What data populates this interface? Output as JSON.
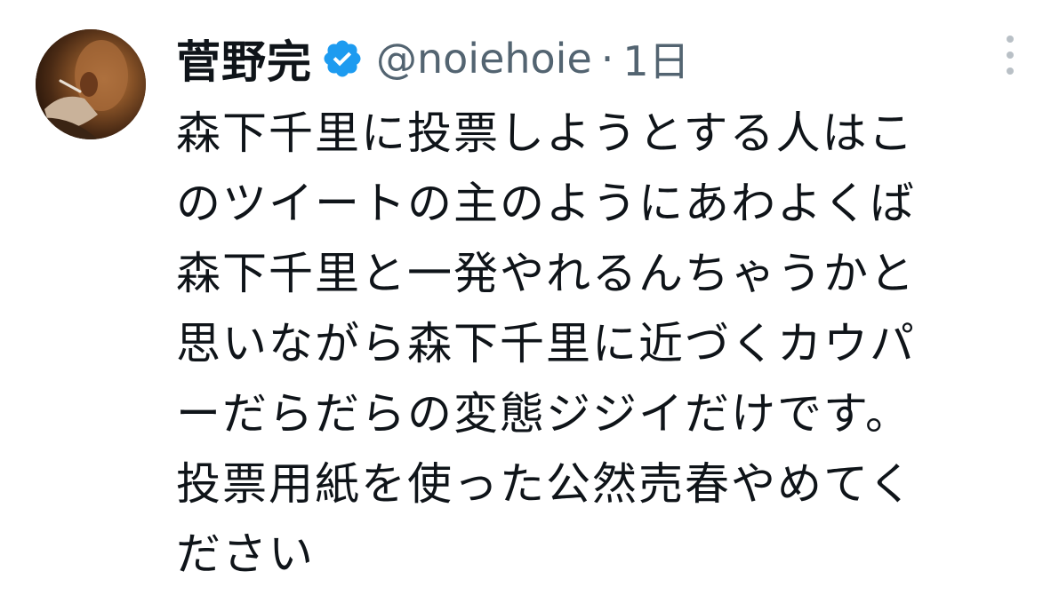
{
  "tweet": {
    "author_name": "菅野完",
    "handle": "@noiehoie",
    "separator": "·",
    "time": "1日",
    "verified_color": "#1d9bf0",
    "icons": {
      "verified": "verified-badge-icon",
      "more": "more-options-icon"
    },
    "body_lines": [
      "森下千里に投票しようとする人はこ",
      "のツイートの主のようにあわよくば",
      "森下千里と一発やれるんちゃうかと",
      "思いながら森下千里に近づくカウパ",
      "ーだらだらの変態ジジイだけです。",
      "投票用紙を使った公然売春やめてく",
      "ださい"
    ]
  }
}
